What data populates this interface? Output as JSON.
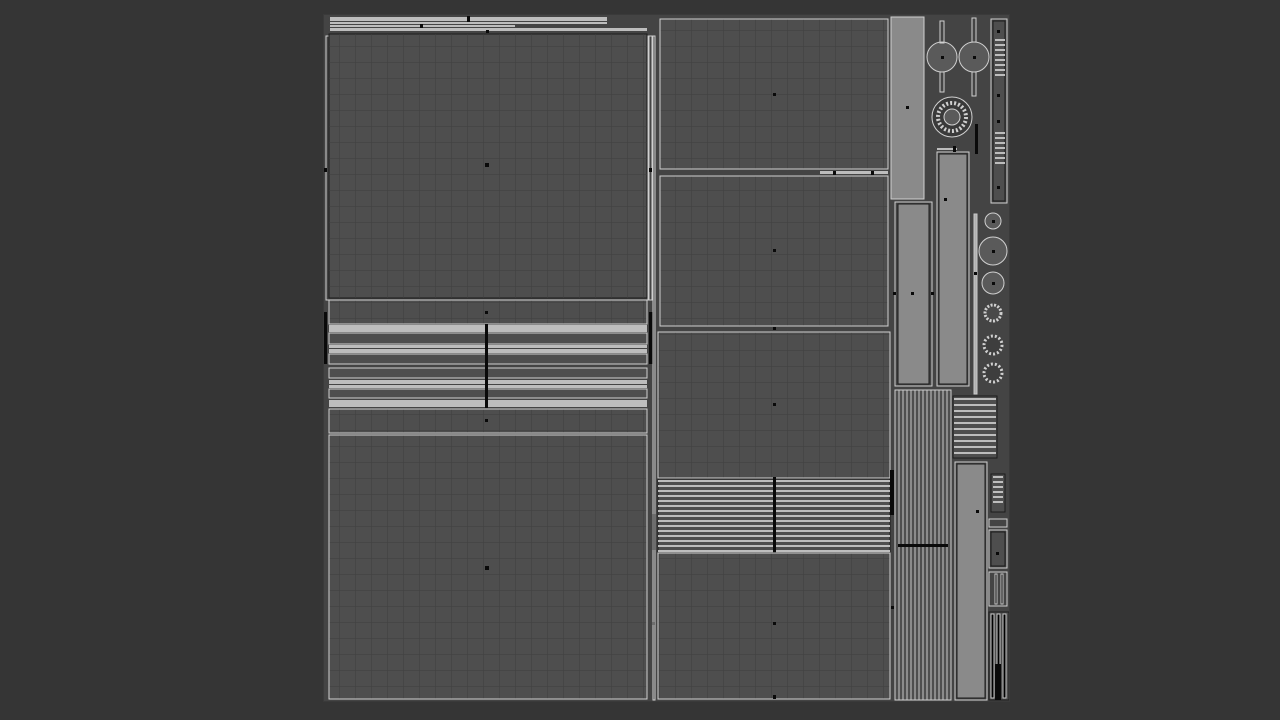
{
  "editor": {
    "view": "uv-editor",
    "background_color": "#353535",
    "sheet_color": "#444444",
    "island_fill_color": "#4e4e4e",
    "island_outline_color": "#d0d0d0",
    "edge_color": "#141414",
    "pivot_color": "#0a0a0a"
  },
  "icons": {
    "pivot": "pivot-dot-icon",
    "uv_island": "uv-island-icon"
  }
}
